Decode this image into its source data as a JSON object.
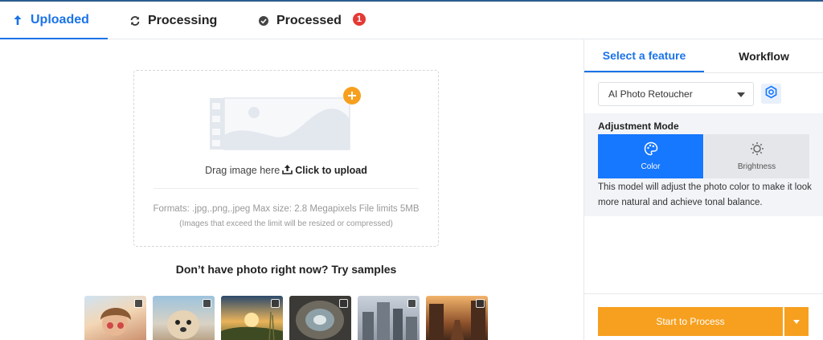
{
  "tabs": {
    "uploaded": "Uploaded",
    "processing": "Processing",
    "processed": "Processed",
    "processed_badge": "1"
  },
  "upload": {
    "drag_text": "Drag image here",
    "click_text": "Click to upload",
    "formats": "Formats: .jpg,.png,.jpeg Max size: 2.8 Megapixels File limits 5MB",
    "note": "(Images that exceed the limit will be resized or compressed)"
  },
  "samples": {
    "title": "Don’t have photo right now? Try samples",
    "items": [
      "portrait-woman",
      "puppy",
      "sunrise-grass",
      "fisheye-tunnel",
      "city-buildings",
      "city-street"
    ]
  },
  "panel": {
    "tab_feature": "Select a feature",
    "tab_workflow": "Workflow",
    "feature_selected": "AI Photo Retoucher",
    "adjustment_title": "Adjustment Mode",
    "mode_color": "Color",
    "mode_brightness": "Brightness",
    "description": "This model will adjust the photo color to make it look more natural and achieve tonal balance.",
    "start_button": "Start to Process"
  },
  "colors": {
    "accent": "#1a73e8",
    "mode_active": "#1677ff",
    "start_button": "#f7a01f",
    "badge": "#e53935"
  }
}
